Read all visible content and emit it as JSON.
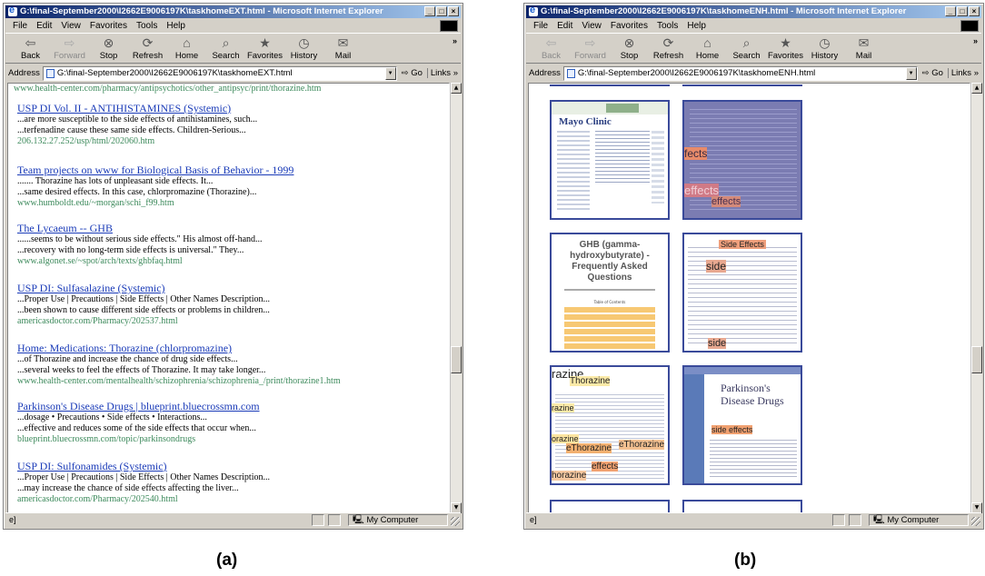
{
  "left": {
    "title": "G:\\final-September2000\\I2662E9006197K\\taskhomeEXT.html - Microsoft Internet Explorer",
    "address": "G:\\final-September2000\\I2662E9006197K\\taskhomeEXT.html",
    "top_url": "www.health-center.com/pharmacy/antipsychotics/other_antipsyc/print/thorazine.htm",
    "results": [
      {
        "title": "USP DI Vol. II - ANTIHISTAMINES (Systemic)",
        "l1": "...are more susceptible to the side effects of antihistamines, such...",
        "l2": "...terfenadine cause these same side effects. Children-Serious...",
        "url": "206.132.27.252/usp/html/202060.htm"
      },
      {
        "title": "Team projects on www for Biological Basis of Behavior - 1999",
        "l1": "....... Thorazine has lots of unpleasant side effects. It...",
        "l2": "...same desired effects. In this case, chlorpromazine (Thorazine)...",
        "url": "www.humboldt.edu/~morgan/schi_f99.htm"
      },
      {
        "title": "The Lycaeum -- GHB",
        "l1": "......seems to be without serious side effects.\" His almost off-hand...",
        "l2": "...recovery with no long-term side effects is universal.\" They...",
        "url": "www.algonet.se/~spot/arch/texts/ghbfaq.html"
      },
      {
        "title": "USP DI: Sulfasalazine (Systemic)",
        "l1": "...Proper Use | Precautions | Side Effects | Other Names Description...",
        "l2": "...been shown to cause different side effects or problems in children...",
        "url": "americasdoctor.com/Pharmacy/202537.html"
      },
      {
        "title": "Home: Medications: Thorazine (chlorpromazine)",
        "l1": "...of Thorazine and increase the chance of drug side effects...",
        "l2": "...several weeks to feel the effects of Thorazine. It may take longer...",
        "url": "www.health-center.com/mentalhealth/schizophrenia/schizophrenia_/print/thorazine1.htm"
      },
      {
        "title": "Parkinson's Disease Drugs | blueprint.bluecrossmn.com",
        "l1": "...dosage • Precautions • Side effects • Interactions...",
        "l2": "...effective and reduces some of the side effects that occur when...",
        "url": "blueprint.bluecrossmn.com/topic/parkinsondrugs"
      },
      {
        "title": "USP DI: Sulfonamides (Systemic)",
        "l1": "...Proper Use | Precautions | Side Effects | Other Names Description...",
        "l2": "...may increase the chance of side effects affecting the liver...",
        "url": "americasdoctor.com/Pharmacy/202540.html"
      }
    ]
  },
  "right": {
    "title": "G:\\final-September2000\\I2662E9006197K\\taskhomeENH.html - Microsoft Internet Explorer",
    "address": "G:\\final-September2000\\I2662E9006197K\\taskhomeENH.html",
    "thumb1_title": "Mayo Clinic",
    "thumb3_title": "GHB (gamma-hydroxybutyrate) - Frequently Asked Questions",
    "thumb3_toc": "Table of Contents",
    "thumb6_title": "Parkinson's Disease Drugs",
    "words": {
      "fects": "fects",
      "effects": "effects",
      "side_effects": "Side Effects",
      "side": "side",
      "thorazine": "Thorazine",
      "horazine": "horazine",
      "razine": "razine",
      "orazine": "orazine",
      "ethorazine": "eThorazine",
      "side_effects_lc": "side effects"
    }
  },
  "menu": [
    "File",
    "Edit",
    "View",
    "Favorites",
    "Tools",
    "Help"
  ],
  "toolbar": [
    "Back",
    "Forward",
    "Stop",
    "Refresh",
    "Home",
    "Search",
    "Favorites",
    "History",
    "Mail"
  ],
  "address_label": "Address",
  "go_label": "Go",
  "links_label": "Links",
  "status_zone": "My Computer",
  "captions": [
    "(a)",
    "(b)"
  ]
}
